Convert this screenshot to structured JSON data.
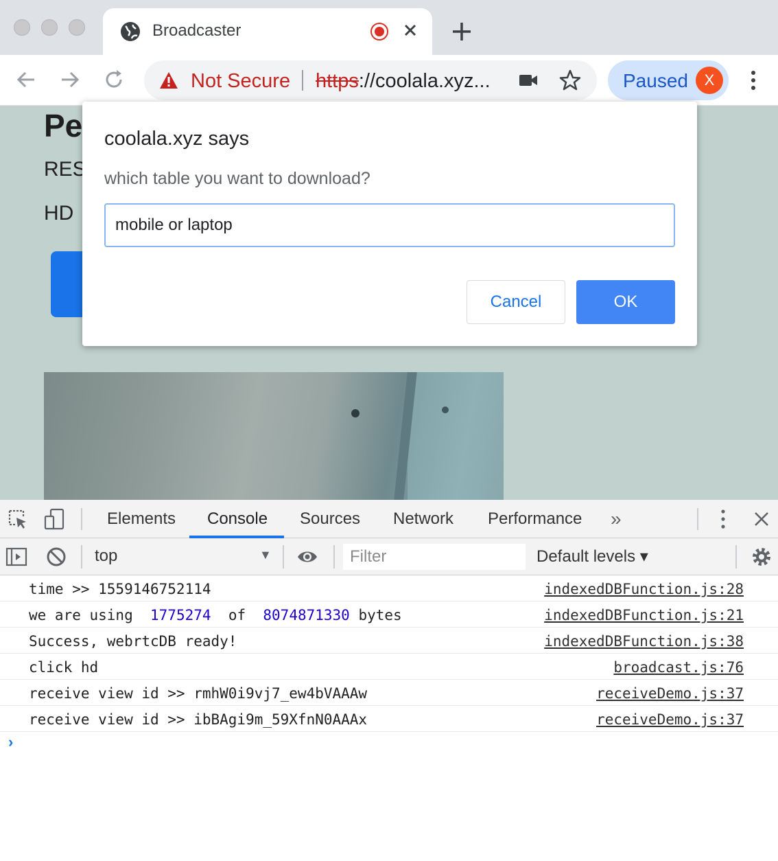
{
  "browser": {
    "tab": {
      "title": "Broadcaster"
    },
    "omnibox": {
      "security_label": "Not Secure",
      "url_protocol": "https",
      "url_rest": "://coolala.xyz..."
    },
    "profile": {
      "label": "Paused",
      "avatar_letter": "X"
    }
  },
  "page": {
    "heading_partial": "Pe",
    "res_partial": "RES",
    "hd_partial": "HD"
  },
  "dialog": {
    "title": "coolala.xyz says",
    "message": "which table you want to download?",
    "input_value": "mobile or laptop",
    "cancel_label": "Cancel",
    "ok_label": "OK"
  },
  "devtools": {
    "tabs": [
      "Elements",
      "Console",
      "Sources",
      "Network",
      "Performance"
    ],
    "active_tab": "Console",
    "more_label": "»",
    "context": "top",
    "filter_placeholder": "Filter",
    "levels_label": "Default levels ▾",
    "console": [
      {
        "text": "time >> 1559146752114",
        "source": "indexedDBFunction.js:28"
      },
      {
        "pre": "we are using  ",
        "n1": "1775274",
        "mid": "  of  ",
        "n2": "8074871330",
        "post": " bytes",
        "source": "indexedDBFunction.js:21"
      },
      {
        "text": "Success, webrtcDB ready!",
        "source": "indexedDBFunction.js:38"
      },
      {
        "text": "click hd",
        "source": "broadcast.js:76"
      },
      {
        "text": "receive view id >> rmhW0i9vj7_ew4bVAAAw",
        "source": "receiveDemo.js:37"
      },
      {
        "text": "receive view id >> ibBAgi9m_59XfnN0AAAx",
        "source": "receiveDemo.js:37"
      }
    ],
    "prompt": "›"
  },
  "colors": {
    "accent": "#1a73e8",
    "danger": "#c5221f",
    "page_bg": "#c1d1ce",
    "console_number": "#1c00cf"
  }
}
